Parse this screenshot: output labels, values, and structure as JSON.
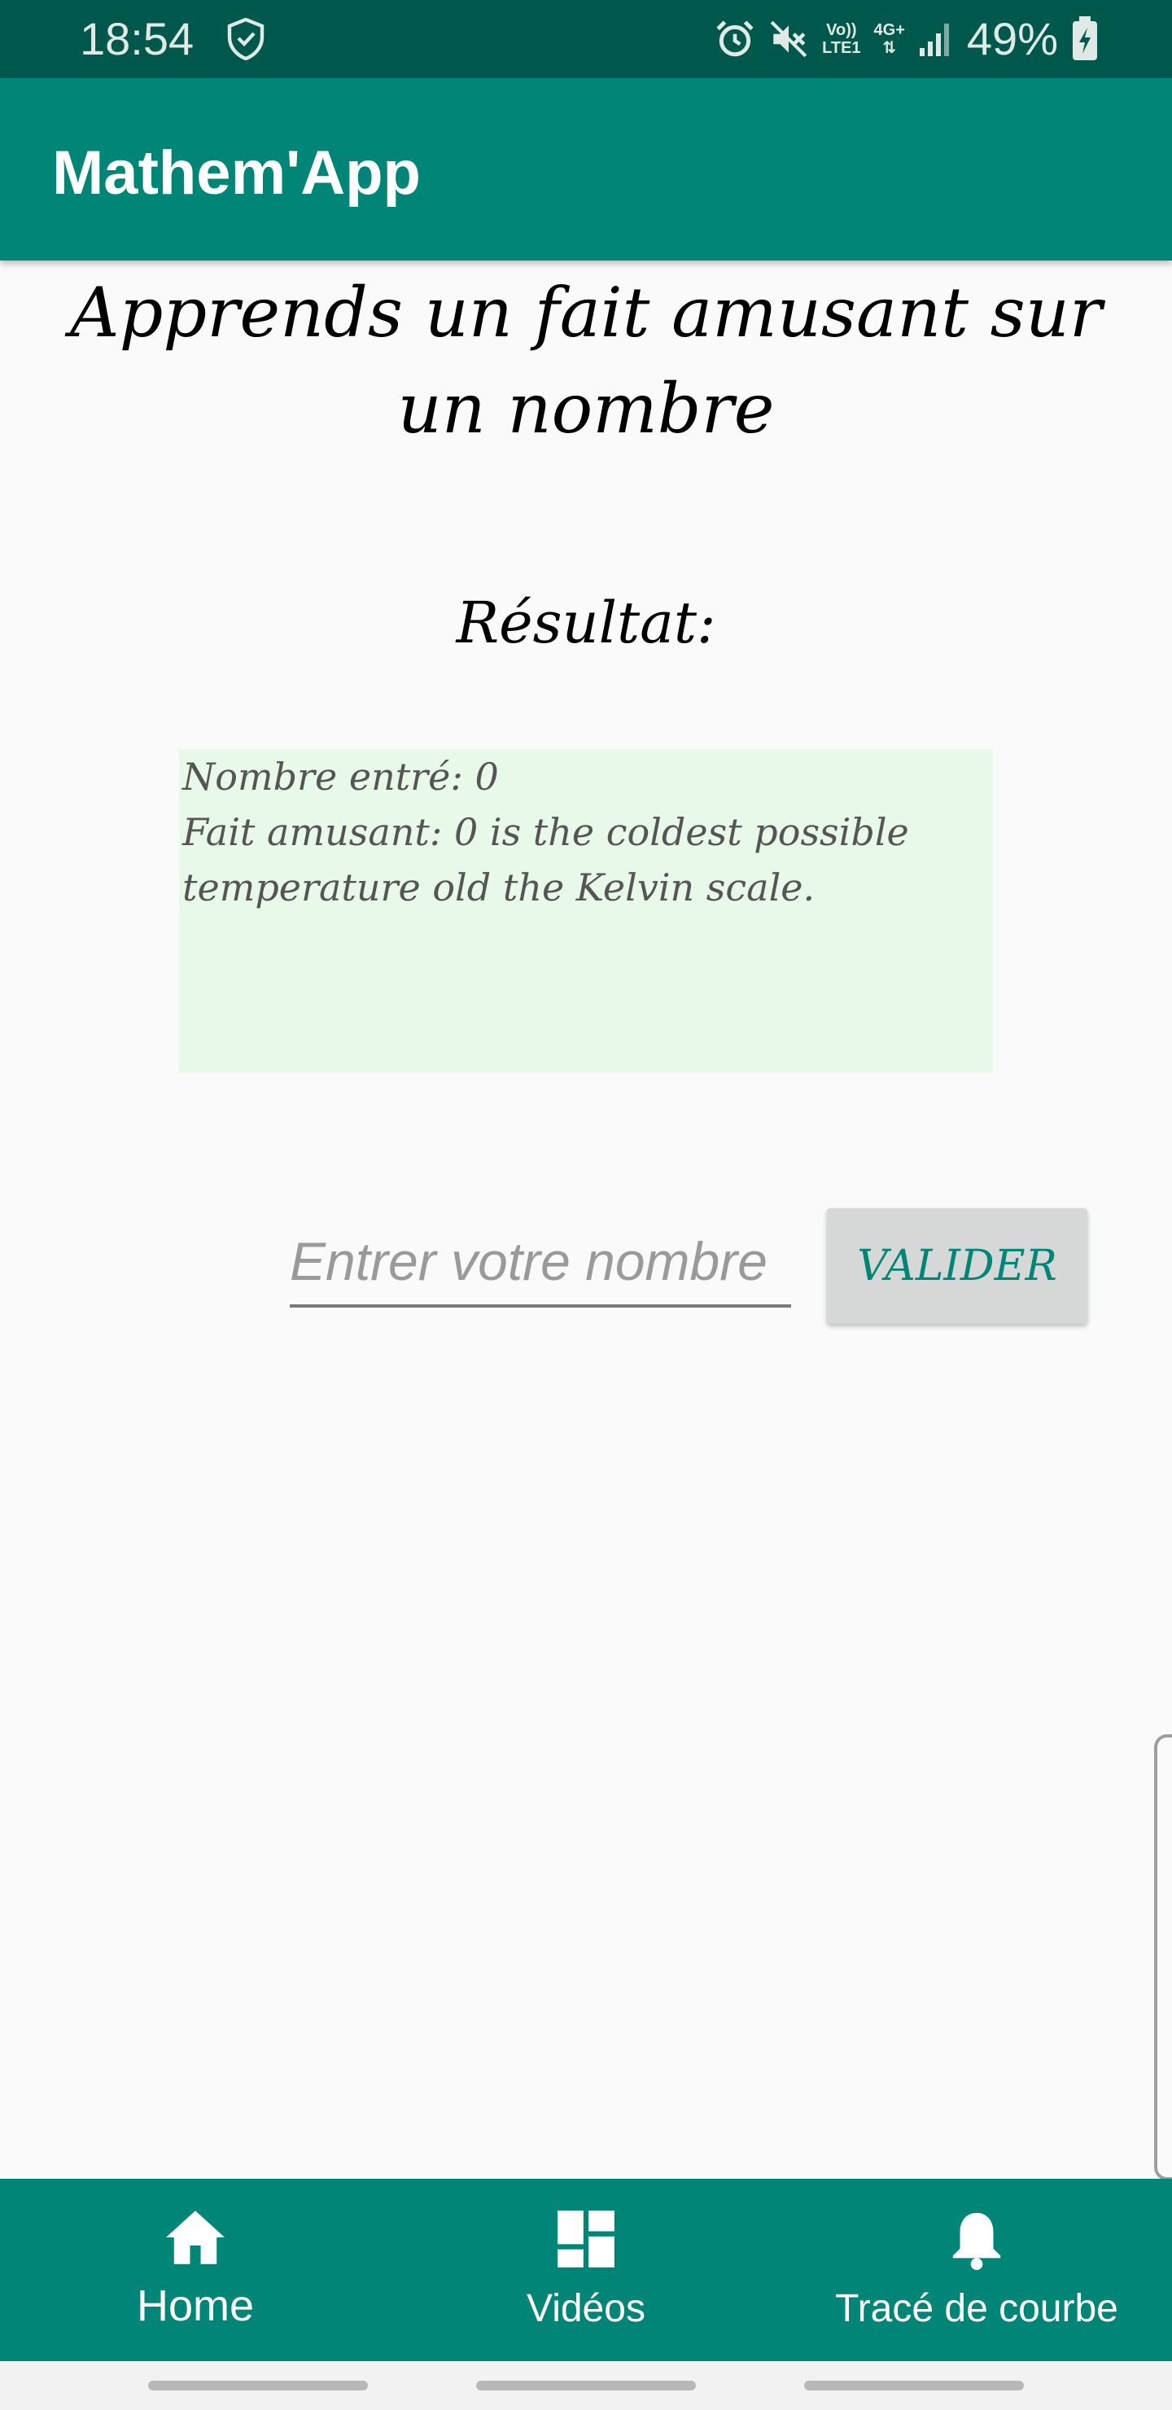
{
  "status_bar": {
    "time": "18:54",
    "network": "4G+",
    "volte_line1": "Vo))",
    "volte_line2": "LTE1",
    "battery": "49%"
  },
  "app_bar": {
    "title": "Mathem'App"
  },
  "main": {
    "heading": "Apprends un fait amusant sur un nombre",
    "result_label": "Résultat:",
    "result": {
      "number_line": "Nombre entré: 0",
      "fact_line": "Fait amusant: 0 is the coldest possible temperature old the Kelvin scale."
    },
    "input": {
      "placeholder": "Entrer votre nombre",
      "value": ""
    },
    "validate_label": "VALIDER"
  },
  "bottom_nav": {
    "items": [
      {
        "label": "Home",
        "icon": "home-icon"
      },
      {
        "label": "Vidéos",
        "icon": "dashboard-icon"
      },
      {
        "label": "Tracé de courbe",
        "icon": "notifications-icon"
      }
    ]
  },
  "colors": {
    "primary": "#008577",
    "primary_dark": "#00574b",
    "result_background": "#e9f9e9",
    "button_background": "#d6d7d7"
  }
}
